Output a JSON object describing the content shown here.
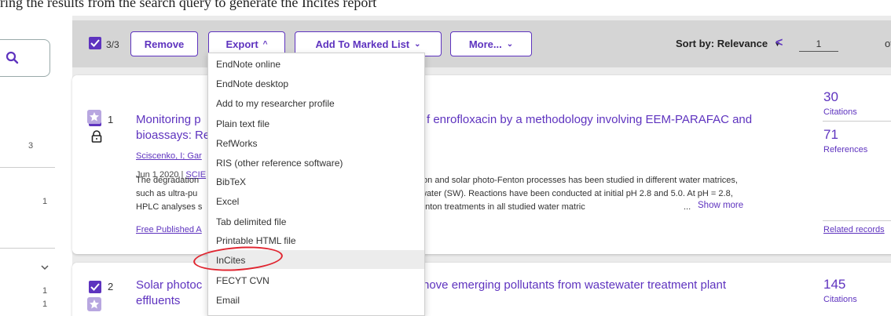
{
  "top_text": "ring the results from the search query to generate the Incites report",
  "sidebar": {
    "counts": [
      "3",
      "1",
      "1",
      "1"
    ]
  },
  "toolbar": {
    "selection_count": "3/3",
    "remove_label": "Remove",
    "export_label": "Export",
    "add_marked_list_label": "Add To Marked List",
    "more_label": "More...",
    "sort_label": "Sort by: Relevance",
    "page_value": "1",
    "page_of": "of"
  },
  "export_menu": {
    "items": [
      "EndNote online",
      "EndNote desktop",
      "Add to my researcher profile",
      "Plain text file",
      "RefWorks",
      "RIS (other reference software)",
      "BibTeX",
      "Excel",
      "Tab delimited file",
      "Printable HTML file",
      "InCites",
      "FECYT CVN",
      "Email"
    ],
    "highlighted": "InCites"
  },
  "results": [
    {
      "number": "1",
      "title_line1_left": "Monitoring p",
      "title_line1_right": "f enrofloxacin by a methodology involving EEM-PARAFAC and",
      "title_line2": "bioassays: Re",
      "authors": "Sciscenko, I; Gar",
      "date_prefix": "Jun 1 2020 | ",
      "date_link": "SCIE",
      "abstract_left": [
        "The degradation",
        "such as ultra-pu",
        "HPLC analyses s"
      ],
      "abstract_right": [
        "ton and solar photo-Fenton processes has been studied in different water matrices,",
        "water (SW). Reactions have been conducted at initial pH 2.8 and 5.0. At pH = 2.8,",
        "enton treatments in all studied water matric"
      ],
      "ellipsis": "...",
      "show_more": "Show more",
      "free_link": "Free Published A",
      "citations": "30",
      "citations_label": "Citations",
      "references": "71",
      "references_label": "References",
      "related": "Related records"
    },
    {
      "number": "2",
      "title_line1_left": "Solar photoc",
      "title_line1_right": "nove emerging pollutants from wastewater treatment plant",
      "title_line2": "effluents",
      "citations": "145",
      "citations_label": "Citations"
    }
  ],
  "colors": {
    "accent": "#5e33bf",
    "annotation": "#e0242f"
  }
}
